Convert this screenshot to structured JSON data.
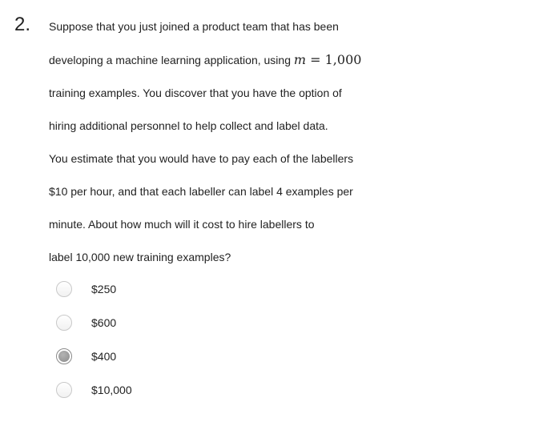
{
  "question": {
    "number": "2.",
    "lines": [
      "Suppose that you just joined a product team that has been",
      "developing a machine learning application, using ",
      "training examples. You discover that you have the option of",
      "hiring additional personnel to help collect and label data.",
      "You estimate that you would have to pay each of the labellers",
      "$10 per hour, and that each labeller can label 4 examples per",
      "minute. About how much will it cost to hire labellers to",
      "label 10,000 new training examples?"
    ],
    "math": {
      "variable": "m",
      "operator": " = ",
      "value": "1,000"
    }
  },
  "options": [
    {
      "label": "$250",
      "selected": false
    },
    {
      "label": "$600",
      "selected": false
    },
    {
      "label": "$400",
      "selected": true
    },
    {
      "label": "$10,000",
      "selected": false
    }
  ],
  "colors": {
    "text": "#222222",
    "radio_border": "#c9c9c9",
    "radio_selected_fill": "#8c8c8c"
  }
}
